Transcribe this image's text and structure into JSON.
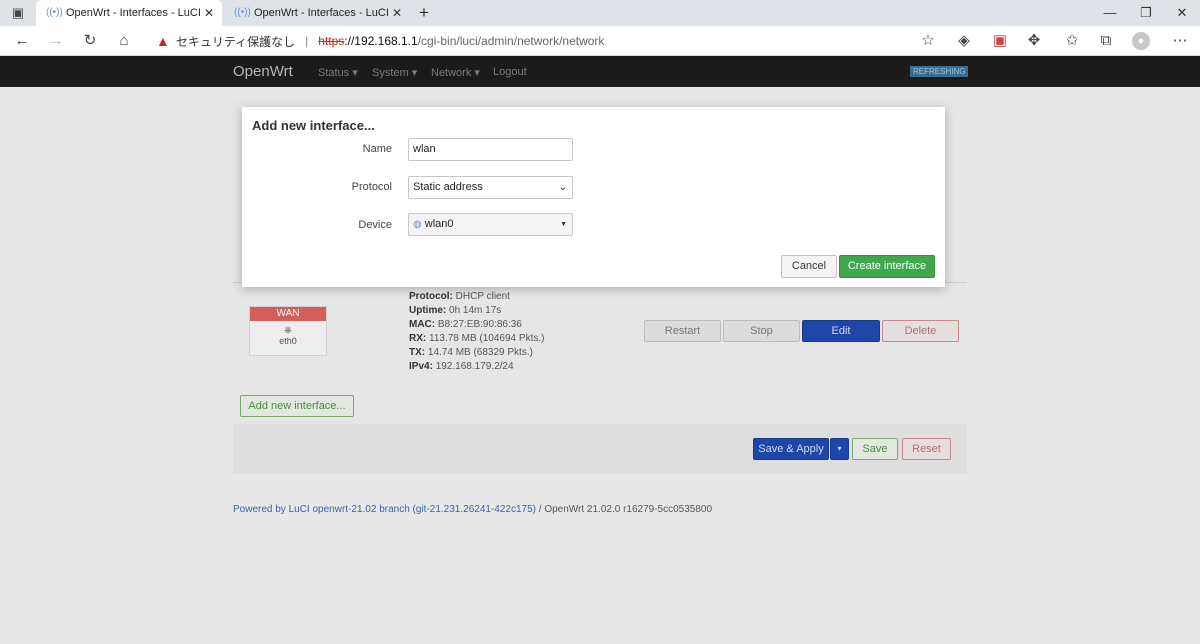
{
  "browser": {
    "tabs": [
      {
        "title": "OpenWrt - Interfaces - LuCI",
        "active": true
      },
      {
        "title": "OpenWrt - Interfaces - LuCI",
        "active": false
      }
    ],
    "security_warning": "セキュリティ保護なし",
    "url_scheme": "https",
    "url_host": "://192.168.1.1",
    "url_path": "/cgi-bin/luci/admin/network/network"
  },
  "nav": {
    "brand": "OpenWrt",
    "items": [
      "Status ▾",
      "System ▾",
      "Network ▾",
      "Logout"
    ],
    "badge": "REFRESHING"
  },
  "wan": {
    "label": "WAN",
    "device": "eth0",
    "info": [
      {
        "key": "Protocol:",
        "value": "DHCP client"
      },
      {
        "key": "Uptime:",
        "value": "0h 14m 17s"
      },
      {
        "key": "MAC:",
        "value": "B8:27:EB:90:86:36"
      },
      {
        "key": "RX:",
        "value": "113.78 MB (104694 Pkts.)"
      },
      {
        "key": "TX:",
        "value": "14.74 MB (68329 Pkts.)"
      },
      {
        "key": "IPv4:",
        "value": "192.168.179.2/24"
      }
    ],
    "buttons": {
      "restart": "Restart",
      "stop": "Stop",
      "edit": "Edit",
      "delete": "Delete"
    }
  },
  "page": {
    "add_interface": "Add new interface...",
    "save_apply": "Save & Apply",
    "save": "Save",
    "reset": "Reset"
  },
  "footer": {
    "link": "Powered by LuCI openwrt-21.02 branch (git-21.231.26241-422c175)",
    "version": " / OpenWrt 21.02.0 r16279-5cc0535800"
  },
  "modal": {
    "title": "Add new interface...",
    "name_label": "Name",
    "name_value": "wlan",
    "protocol_label": "Protocol",
    "protocol_value": "Static address",
    "device_label": "Device",
    "device_value": "wlan0",
    "cancel": "Cancel",
    "create": "Create interface"
  }
}
